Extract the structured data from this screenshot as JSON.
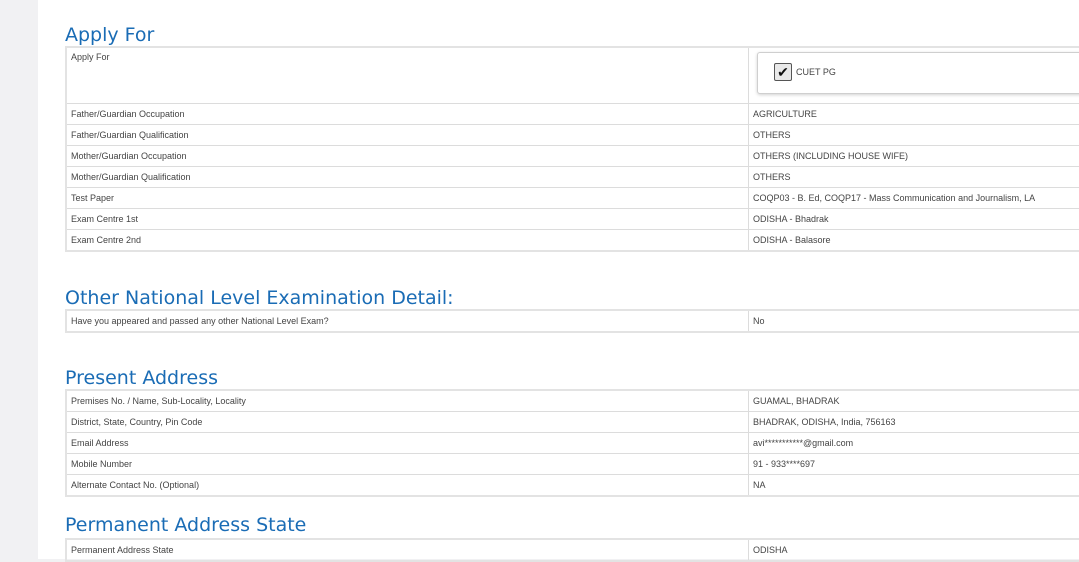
{
  "apply_for": {
    "title": "Apply For",
    "row_label": "Apply For",
    "checkbox_label": "CUET PG",
    "checked": true,
    "rows": [
      {
        "label": "Father/Guardian Occupation",
        "value": "AGRICULTURE"
      },
      {
        "label": "Father/Guardian Qualification",
        "value": "OTHERS"
      },
      {
        "label": "Mother/Guardian Occupation",
        "value": "OTHERS (INCLUDING HOUSE WIFE)"
      },
      {
        "label": "Mother/Guardian Qualification",
        "value": "OTHERS"
      },
      {
        "label": "Test Paper",
        "value": "COQP03 - B. Ed, COQP17 - Mass Communication and Journalism, LA"
      },
      {
        "label": "Exam Centre 1st",
        "value": "ODISHA - Bhadrak"
      },
      {
        "label": "Exam Centre 2nd",
        "value": "ODISHA - Balasore"
      }
    ]
  },
  "national_exam": {
    "title": "Other National Level Examination Detail:",
    "rows": [
      {
        "label": "Have you appeared and passed any other National Level Exam?",
        "value": "No"
      }
    ]
  },
  "present_address": {
    "title": "Present Address",
    "rows": [
      {
        "label": "Premises No. / Name, Sub-Locality, Locality",
        "value": "GUAMAL, BHADRAK"
      },
      {
        "label": "District, State, Country, Pin Code",
        "value": "BHADRAK, ODISHA, India, 756163"
      },
      {
        "label": "Email Address",
        "value": "avi***********@gmail.com"
      },
      {
        "label": "Mobile Number",
        "value": "91 - 933****697"
      },
      {
        "label": "Alternate Contact No. (Optional)",
        "value": "NA"
      }
    ]
  },
  "permanent_address": {
    "title": "Permanent Address State",
    "rows": [
      {
        "label": "Permanent Address State",
        "value": "ODISHA"
      }
    ]
  },
  "colors": {
    "heading": "#1a6cb5",
    "background": "#f1f1f3",
    "border": "#dcdcdc"
  }
}
